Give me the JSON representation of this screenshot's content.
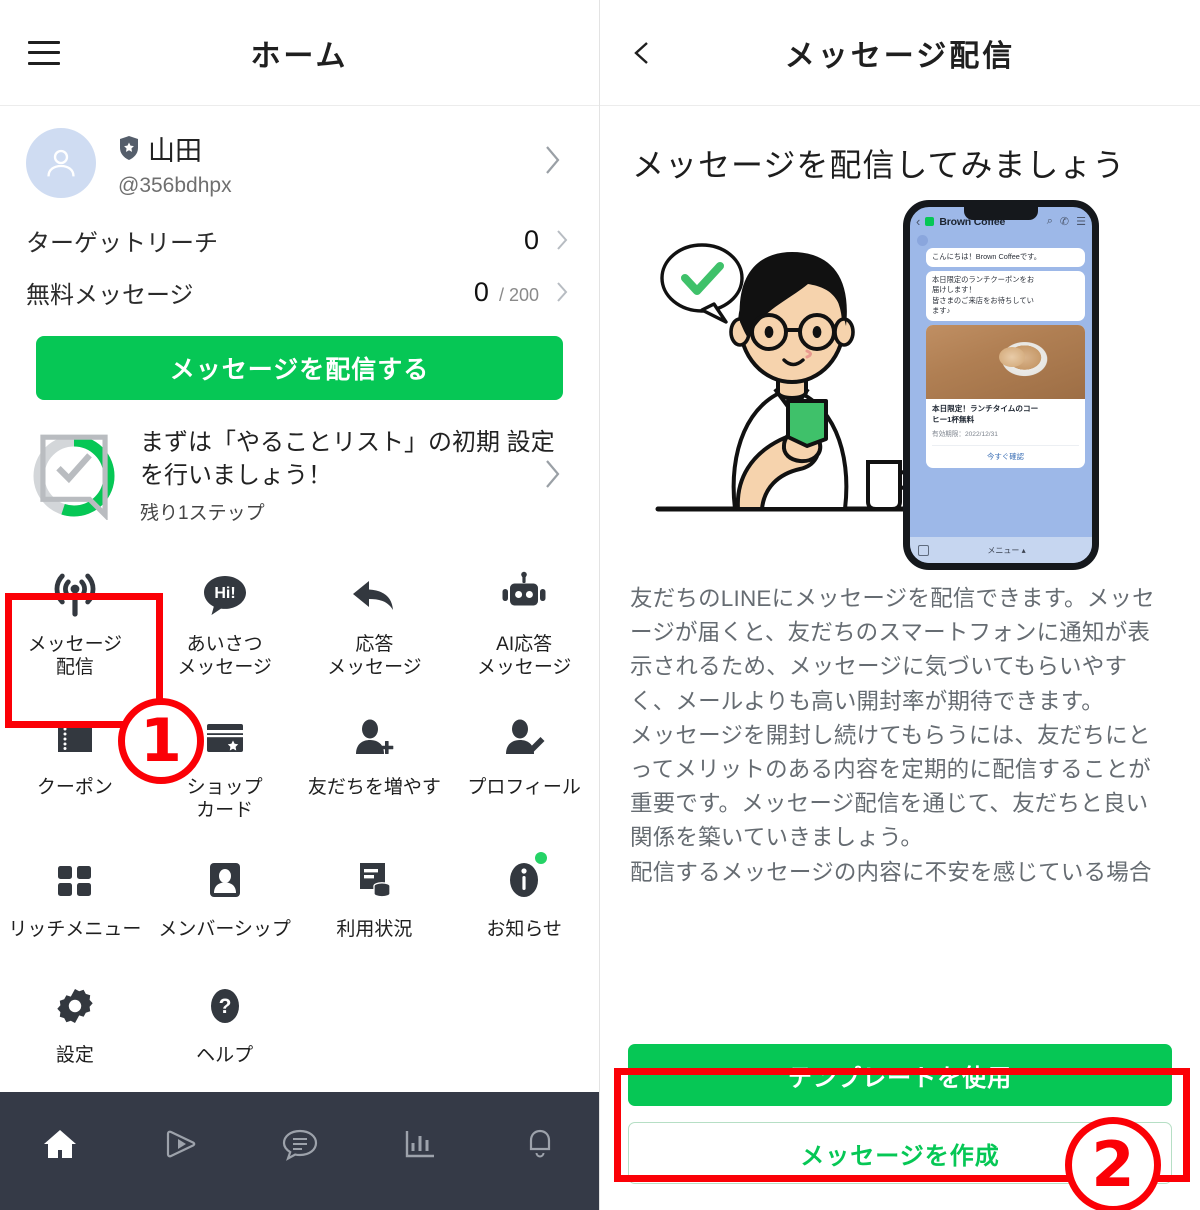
{
  "left": {
    "topbar": {
      "menu_icon": "hamburger-icon",
      "title": "ホーム"
    },
    "profile": {
      "badge_icon": "shield-check-icon",
      "name": "山田",
      "account_id": "@356bdhpx",
      "chevron_icon": "chevron-right-icon"
    },
    "stats": [
      {
        "label": "ターゲットリーチ",
        "value": "0",
        "total": ""
      },
      {
        "label": "無料メッセージ",
        "value": "0",
        "total": "/ 200"
      }
    ],
    "primary_button": "メッセージを配信する",
    "todo": {
      "title": "まずは「やることリスト」の初期\n設定を行いましょう！",
      "subtitle": "残り1ステップ",
      "progress_percent": 55,
      "ring_color": "#06c755",
      "ring_track_color": "#d3d6d9",
      "icon": "checklist-icon"
    },
    "grid": [
      {
        "icon": "broadcast-icon",
        "label": "メッセージ\n配信",
        "highlighted": true
      },
      {
        "icon": "greeting-hi-icon",
        "label": "あいさつ\nメッセージ"
      },
      {
        "icon": "reply-arrow-icon",
        "label": "応答\nメッセージ"
      },
      {
        "icon": "robot-icon",
        "label": "AI応答\nメッセージ"
      },
      {
        "icon": "coupon-icon",
        "label": "クーポン"
      },
      {
        "icon": "shop-card-icon",
        "label": "ショップ\nカード"
      },
      {
        "icon": "add-friend-icon",
        "label": "友だちを増やす"
      },
      {
        "icon": "profile-edit-icon",
        "label": "プロフィール"
      },
      {
        "icon": "rich-menu-icon",
        "label": "リッチメニュー"
      },
      {
        "icon": "membership-icon",
        "label": "メンバーシップ"
      },
      {
        "icon": "usage-icon",
        "label": "利用状況"
      },
      {
        "icon": "info-icon",
        "label": "お知らせ",
        "badge": true
      },
      {
        "icon": "gear-icon",
        "label": "設定"
      },
      {
        "icon": "help-icon",
        "label": "ヘルプ"
      }
    ],
    "bottom_nav": [
      {
        "icon": "home-icon",
        "active": true
      },
      {
        "icon": "live-play-icon"
      },
      {
        "icon": "chat-icon"
      },
      {
        "icon": "analytics-bar-icon"
      },
      {
        "icon": "bell-icon"
      }
    ]
  },
  "right": {
    "topbar": {
      "back_icon": "chevron-left-icon",
      "title": "メッセージ配信"
    },
    "heading": "メッセージを配信してみましょう",
    "illustration": {
      "name": "person-with-phone-illustration",
      "bubble_icon": "check-mark-icon",
      "mug_icon": "coffee-mug-icon"
    },
    "phone_mockup": {
      "chat_name": "Brown Coffee",
      "back_icon": "chevron-left-icon",
      "header_icons": [
        "search-icon",
        "call-icon",
        "menu-icon"
      ],
      "messages": [
        "こんにちは！Brown Coffeeです。",
        "本日限定のランチクーポンをお\n届けします！\n皆さまのご来店をお待ちしてい\nます♪"
      ],
      "card": {
        "title": "本日限定！ランチタイムのコー\nヒー1杯無料",
        "date": "有効期限：2022/12/31",
        "action": "今すぐ確認"
      },
      "footer": {
        "keyboard_icon": "emoji-icon",
        "menu_label": "メニュー ▴"
      }
    },
    "body_text": "友だちのLINEにメッセージを配信できます。メッセージが届くと、友だちのスマートフォンに通知が表示されるため、メッセージに気づいてもらいやすく、メールよりも高い開封率が期待できます。\nメッセージを開封し続けてもらうには、友だちにとってメリットのある内容を定期的に配信することが重要です。メッセージ配信を通じて、友だちと良い関係を築いていきましょう。\n配信するメッセージの内容に不安を感じている場合",
    "template_button": "テンプレートを使用",
    "create_button": "メッセージを作成"
  },
  "annotations": [
    {
      "name": "step-1-marker",
      "label": "①",
      "number": "1"
    },
    {
      "name": "step-2-marker",
      "label": "②",
      "number": "2"
    }
  ],
  "colors": {
    "line_green": "#06c755",
    "annotation_red": "#fb0006",
    "nav_dark": "#353a47"
  }
}
